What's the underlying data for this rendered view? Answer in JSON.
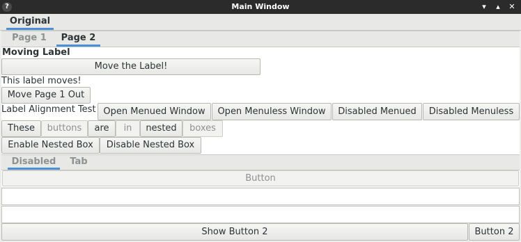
{
  "window": {
    "title": "Main Window"
  },
  "titlebar_icons": {
    "app": "?",
    "minimize": "▾",
    "maximize": "▴",
    "close": "✕"
  },
  "outer_tabs": [
    {
      "label": "Original"
    }
  ],
  "inner_tabs": [
    {
      "label": "Page 1"
    },
    {
      "label": "Page 2"
    }
  ],
  "page2": {
    "moving_label": "Moving Label",
    "move_button": "Move the Label!",
    "moves_label": "This label moves!",
    "move_page_button": "Move Page 1 Out",
    "align_label": "Label Alignment Test",
    "open_menued": "Open Menued Window",
    "open_menuless": "Open Menuless Window",
    "disabled_menued": "Disabled Menued",
    "disabled_menuless": "Disabled Menuless",
    "nested": [
      "These",
      "buttons",
      "are",
      "in",
      "nested",
      "boxes"
    ],
    "enable_nested": "Enable Nested Box",
    "disable_nested": "Disable Nested Box"
  },
  "disabled_tabs": [
    {
      "label": "Disabled"
    },
    {
      "label": "Tab"
    }
  ],
  "disabled_button": "Button",
  "bottom": {
    "show_button2": "Show Button 2",
    "button2": "Button 2"
  },
  "colors": {
    "accent": "#4a90d9",
    "titlebar": "#2b2b2b"
  }
}
